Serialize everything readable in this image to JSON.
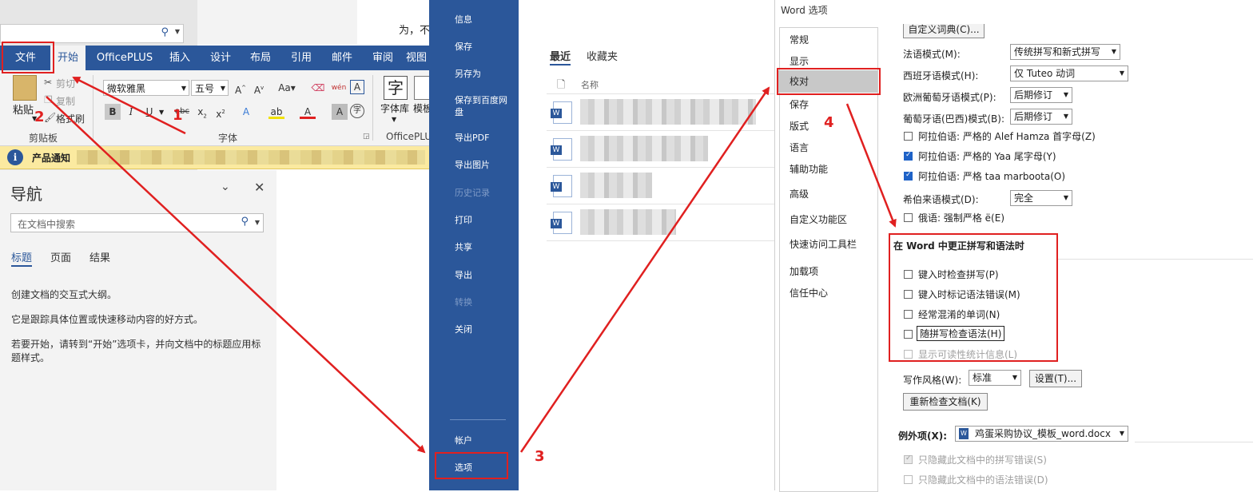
{
  "word": {
    "ribbon_tabs": [
      "文件",
      "开始",
      "OfficePLUS",
      "插入",
      "设计",
      "布局",
      "引用",
      "邮件",
      "审阅",
      "视图"
    ],
    "doc_text": "为，不",
    "clipboard": {
      "paste": "粘贴",
      "cut": "剪切",
      "copy": "复制",
      "format_painter": "格式刷",
      "label": "剪贴板"
    },
    "font": {
      "name": "微软雅黑",
      "size": "五号",
      "label": "字体"
    },
    "officeplus": {
      "font_lib": "字体库",
      "template": "模板",
      "label": "OfficePLUS"
    },
    "notice": {
      "label": "产品通知"
    },
    "nav": {
      "title": "导航",
      "search_placeholder": "在文档中搜索",
      "tabs": [
        "标题",
        "页面",
        "结果"
      ],
      "text1": "创建文档的交互式大纲。",
      "text2": "它是跟踪具体位置或快速移动内容的好方式。",
      "text3": "若要开始，请转到“开始”选项卡，并向文档中的标题应用标题样式。"
    }
  },
  "backstage": {
    "menu": [
      "信息",
      "保存",
      "另存为",
      "保存到百度网盘",
      "导出PDF",
      "导出图片",
      "历史记录",
      "打印",
      "共享",
      "导出",
      "转换",
      "关闭"
    ],
    "bottom": [
      "帐户",
      "选项"
    ],
    "tabs": [
      "最近",
      "收藏夹"
    ],
    "column_name": "名称"
  },
  "options": {
    "title": "Word 选项",
    "sidebar": [
      "常规",
      "显示",
      "校对",
      "保存",
      "版式",
      "语言",
      "辅助功能",
      "高级",
      "自定义功能区",
      "快速访问工具栏",
      "加载项",
      "信任中心"
    ],
    "custom_dict_btn": "自定义词典(C)...",
    "modes": [
      {
        "label": "法语模式(M):",
        "value": "传统拼写和新式拼写"
      },
      {
        "label": "西班牙语模式(H):",
        "value": "仅 Tuteo 动词"
      },
      {
        "label": "欧洲葡萄牙语模式(P):",
        "value": "后期修订"
      },
      {
        "label": "葡萄牙语(巴西)模式(B):",
        "value": "后期修订"
      }
    ],
    "arabic": [
      {
        "label": "阿拉伯语: 严格的 Alef Hamza 首字母(Z)",
        "checked": false
      },
      {
        "label": "阿拉伯语: 严格的 Yaa 尾字母(Y)",
        "checked": true
      },
      {
        "label": "阿拉伯语: 严格 taa marboota(O)",
        "checked": true
      }
    ],
    "hebrew": {
      "label": "希伯来语模式(D):",
      "value": "完全"
    },
    "russian": {
      "label": "俄语: 强制严格 ë(E)",
      "checked": false
    },
    "section_title": "在 Word 中更正拼写和语法时",
    "section_items": [
      {
        "label": "键入时检查拼写(P)",
        "checked": false,
        "disabled": false
      },
      {
        "label": "键入时标记语法错误(M)",
        "checked": false,
        "disabled": false
      },
      {
        "label": "经常混淆的单词(N)",
        "checked": false,
        "disabled": false
      },
      {
        "label": "随拼写检查语法(H)",
        "checked": false,
        "disabled": false
      },
      {
        "label": "显示可读性统计信息(L)",
        "checked": false,
        "disabled": true
      }
    ],
    "writing_style": {
      "label": "写作风格(W):",
      "value": "标准",
      "settings_btn": "设置(T)..."
    },
    "recheck_btn": "重新检查文档(K)",
    "exceptions": {
      "label": "例外项(X):",
      "value": "鸡蛋采购协议_模板_word.docx"
    },
    "exception_items": [
      {
        "label": "只隐藏此文档中的拼写错误(S)",
        "checked": true
      },
      {
        "label": "只隐藏此文档中的语法错误(D)",
        "checked": false
      }
    ]
  },
  "annotations": {
    "steps": [
      "1",
      "2",
      "3",
      "4"
    ],
    "color": "#e02020"
  },
  "colors": {
    "word_blue": "#2b579a",
    "notice_yellow": "#fbeaa0",
    "annotation_red": "#e02020"
  }
}
